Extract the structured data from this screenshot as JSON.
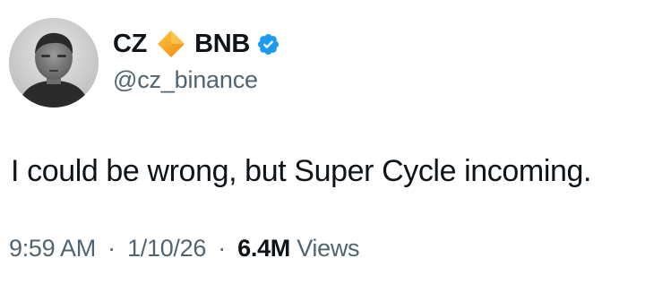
{
  "author": {
    "name_first": "CZ",
    "name_second": "BNB",
    "handle": "@cz_binance",
    "badge_icon": "bnb-diamond-icon",
    "verified_icon": "verified-badge-icon",
    "verified_color": "#1d9bf0",
    "diamond_color": "#f0b90b"
  },
  "tweet": {
    "text": "I could be wrong, but Super Cycle incoming."
  },
  "meta": {
    "time": "9:59 AM",
    "date": "1/10/26",
    "separator": "·",
    "views_count": "6.4M",
    "views_label": "Views"
  }
}
